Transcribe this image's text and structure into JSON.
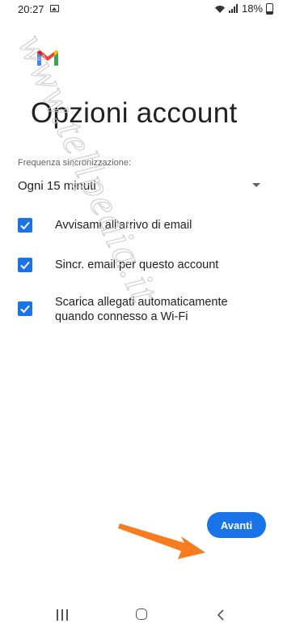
{
  "status_bar": {
    "time": "20:27",
    "battery": "18%"
  },
  "header": {
    "title": "Opzioni account"
  },
  "sync": {
    "label": "Frequenza sincronizzazione:",
    "value": "Ogni 15 minuti"
  },
  "options": [
    {
      "label": "Avvisami all'arrivo di email",
      "checked": true
    },
    {
      "label": "Sincr. email per questo account",
      "checked": true
    },
    {
      "label": "Scarica allegati automaticamente quando connesso a Wi-Fi",
      "checked": true
    }
  ],
  "actions": {
    "next_label": "Avanti"
  },
  "colors": {
    "accent": "#1a73e8",
    "arrow": "#f57c1f"
  },
  "watermark": "www.tellpedia.it"
}
